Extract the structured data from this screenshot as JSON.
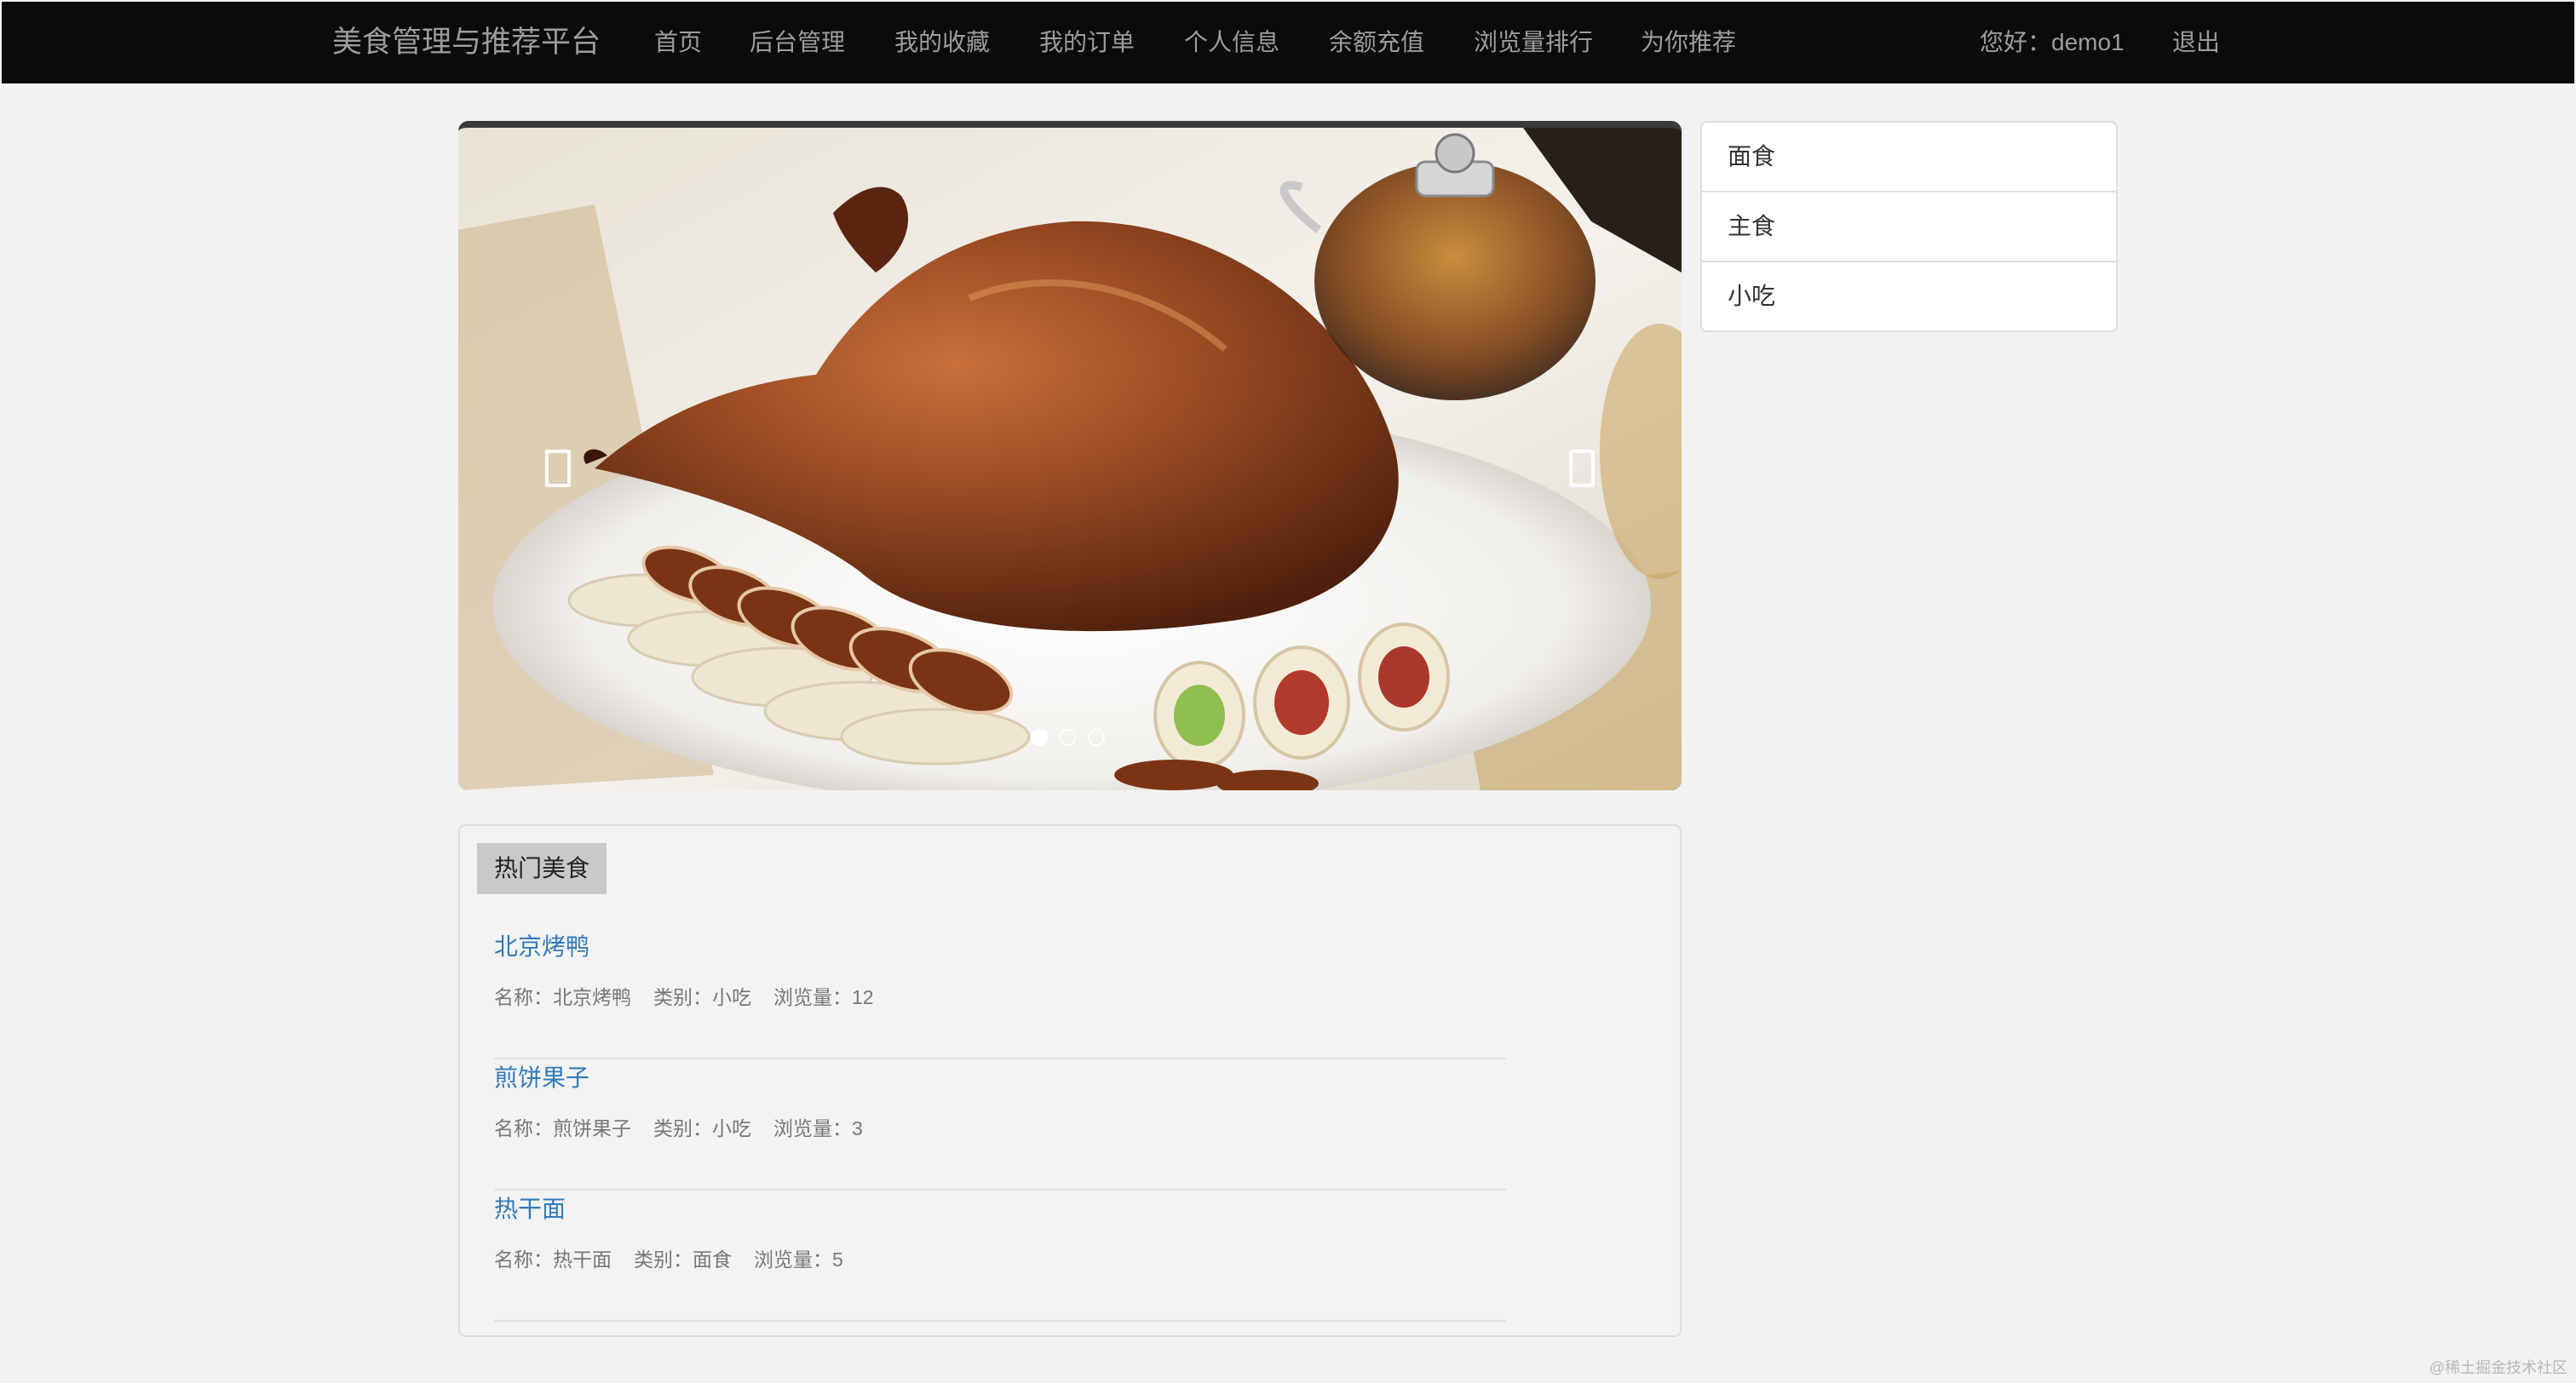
{
  "navbar": {
    "brand": "美食管理与推荐平台",
    "links": [
      "首页",
      "后台管理",
      "我的收藏",
      "我的订单",
      "个人信息",
      "余额充值",
      "浏览量排行",
      "为你推荐"
    ],
    "greeting": "您好：demo1",
    "logout": "退出"
  },
  "carousel": {
    "slide_count": 3,
    "active_index": 0,
    "prev_icon": "chevron-left-icon",
    "next_icon": "chevron-right-icon"
  },
  "categories": [
    "面食",
    "主食",
    "小吃"
  ],
  "hot": {
    "title": "热门美食",
    "name_label": "名称：",
    "category_label": "类别：",
    "views_label": "浏览量：",
    "items": [
      {
        "title": "北京烤鸭",
        "name": "北京烤鸭",
        "category": "小吃",
        "views": "12"
      },
      {
        "title": "煎饼果子",
        "name": "煎饼果子",
        "category": "小吃",
        "views": "3"
      },
      {
        "title": "热干面",
        "name": "热干面",
        "category": "面食",
        "views": "5"
      }
    ]
  },
  "watermark": "@稀土掘金技术社区",
  "colors": {
    "navbar_bg": "#0b0b0b",
    "nav_text": "#9d9d9d",
    "link": "#337ab7",
    "page_bg": "#f2f2f2"
  }
}
